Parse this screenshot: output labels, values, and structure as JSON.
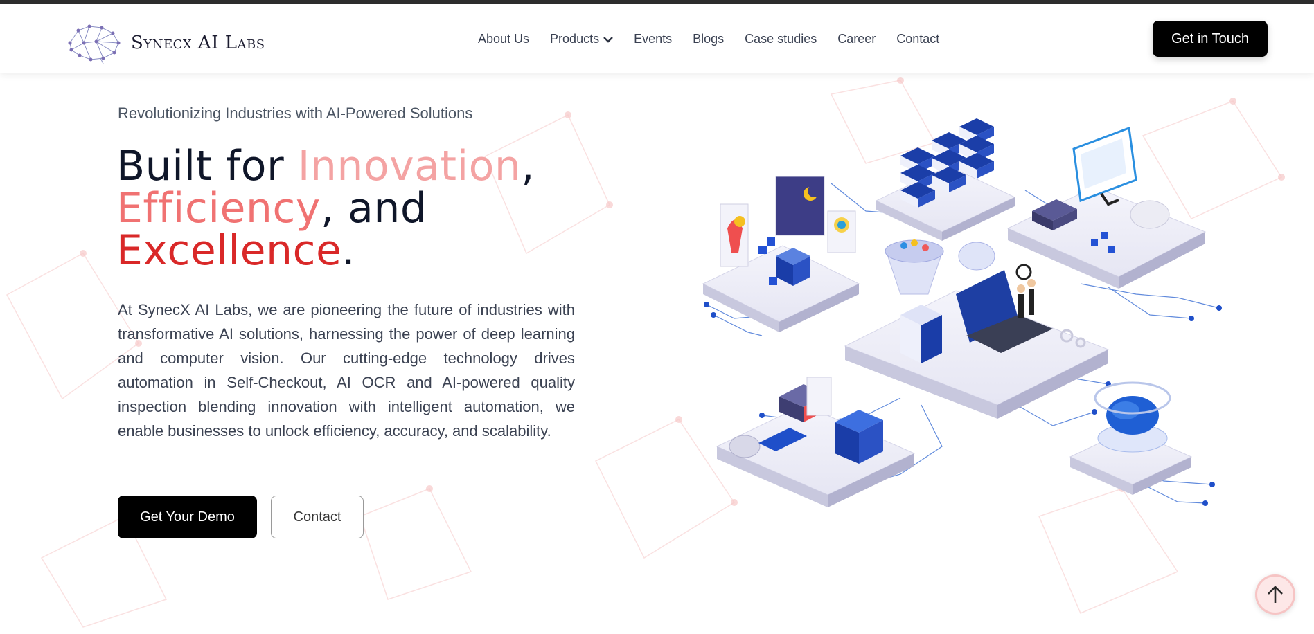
{
  "brand": {
    "name": "Synecx AI Labs",
    "accent_colors": {
      "black": "#000000",
      "pink": "#f4a3a3",
      "coral": "#f07272",
      "red": "#d92828"
    }
  },
  "nav": {
    "items": [
      {
        "label": "About Us"
      },
      {
        "label": "Products",
        "icon": "chevron-down-icon"
      },
      {
        "label": "Events"
      },
      {
        "label": "Blogs"
      },
      {
        "label": "Case studies"
      },
      {
        "label": "Career"
      },
      {
        "label": "Contact"
      }
    ],
    "cta_label": "Get in Touch"
  },
  "hero": {
    "eyebrow": "Revolutionizing Industries with AI-Powered Solutions",
    "headline": {
      "part1": "Built for ",
      "word1": "Innovation",
      "sep1": ",",
      "word2": "Efficiency",
      "sep2": ", and",
      "word3": "Excellence",
      "end": "."
    },
    "description": "At SynecX AI Labs, we are pioneering the future of industries with transformative AI solutions, harnessing the power of deep learning and computer vision. Our cutting-edge technology drives automation in Self-Checkout, AI OCR and AI-powered quality inspection blending innovation with intelligent automation, we enable businesses to unlock efficiency, accuracy, and scalability.",
    "primary_button": "Get Your Demo",
    "secondary_button": "Contact",
    "illustration_icons": [
      "server-rack-icon",
      "monitor-icon",
      "ai-chip-icon",
      "brain-icon",
      "laptop-icon",
      "books-icon",
      "robot-icon"
    ]
  },
  "scroll_top": {
    "icon": "arrow-up-icon"
  }
}
